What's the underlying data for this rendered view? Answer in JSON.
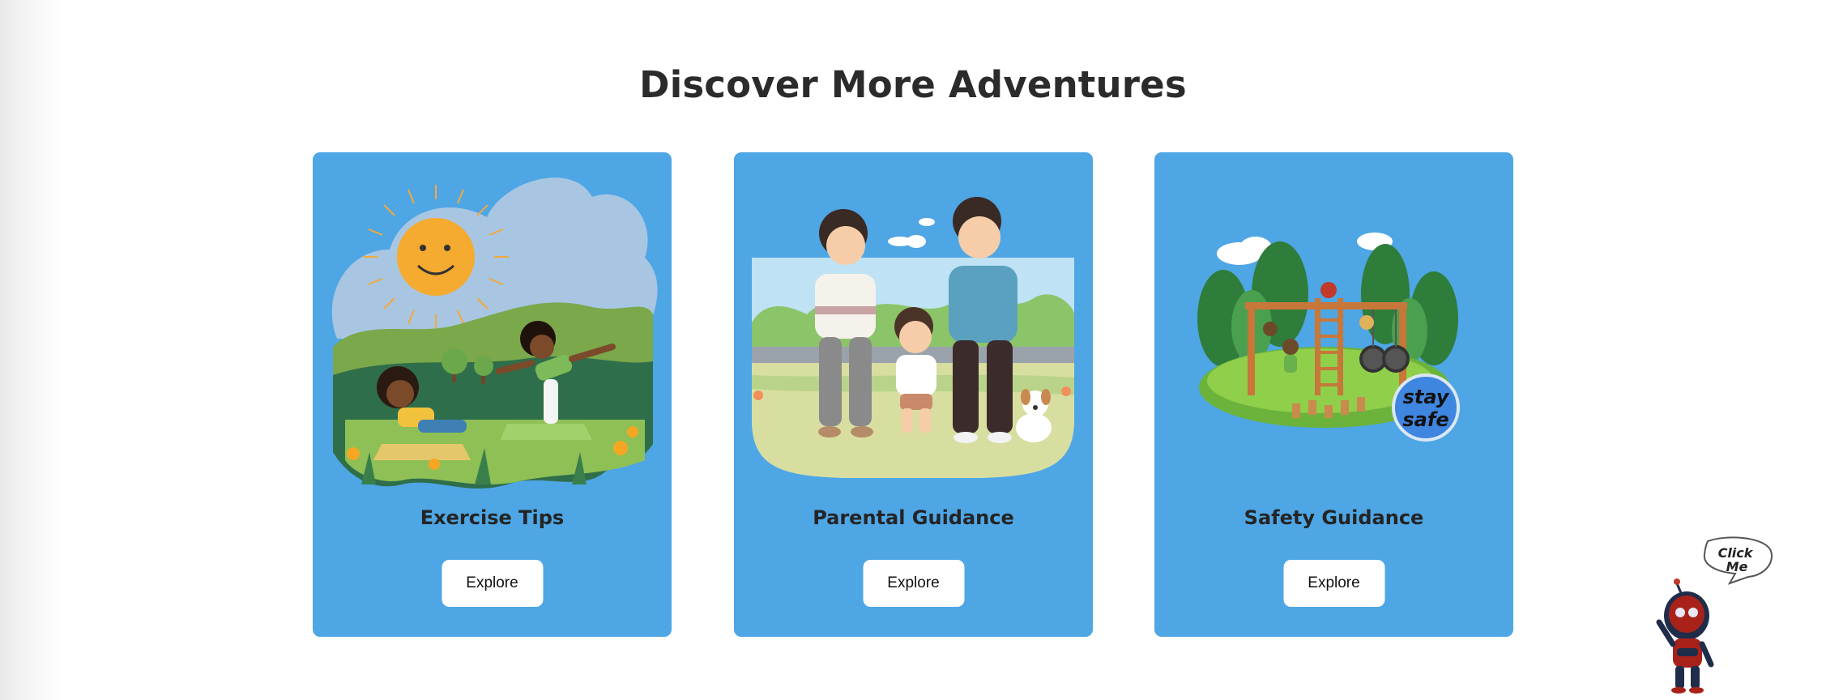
{
  "section": {
    "title": "Discover More Adventures"
  },
  "cards": [
    {
      "title": "Exercise Tips",
      "button_label": "Explore",
      "illustration": "kids-doing-yoga-in-park"
    },
    {
      "title": "Parental Guidance",
      "button_label": "Explore",
      "illustration": "family-walking-with-dog"
    },
    {
      "title": "Safety Guidance",
      "button_label": "Explore",
      "illustration": "kids-on-playground",
      "badge_lines": [
        "stay",
        "safe"
      ]
    }
  ],
  "mascot": {
    "speech_lines": [
      "Click",
      "Me"
    ],
    "icon": "robot-mascot-icon"
  },
  "colors": {
    "card_bg": "#4ea6e5",
    "title_text": "#2b2b2b",
    "button_bg": "#ffffff"
  }
}
